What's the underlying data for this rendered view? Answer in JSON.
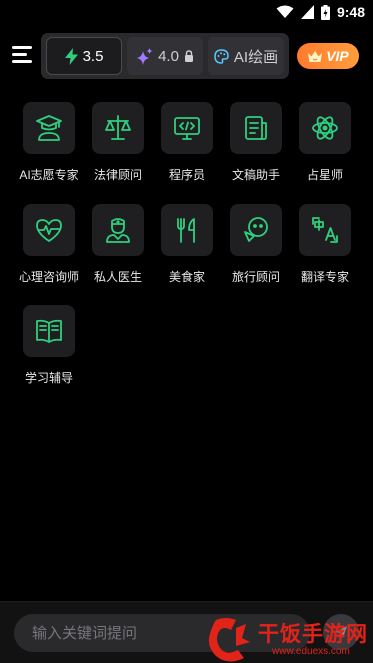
{
  "status_bar": {
    "time": "9:48"
  },
  "top_bar": {
    "models": [
      {
        "label": "3.5",
        "icon": "bolt-icon"
      },
      {
        "label": "4.0",
        "icon": "sparkle-icon",
        "locked": true
      },
      {
        "label": "AI绘画",
        "icon": "palette-icon"
      }
    ],
    "vip_label": "VIP"
  },
  "assistants": [
    {
      "label": "AI志愿专家",
      "icon": "graduate-icon"
    },
    {
      "label": "法律顾问",
      "icon": "scales-icon"
    },
    {
      "label": "程序员",
      "icon": "code-monitor-icon"
    },
    {
      "label": "文稿助手",
      "icon": "document-icon"
    },
    {
      "label": "占星师",
      "icon": "atom-icon"
    },
    {
      "label": "心理咨询师",
      "icon": "heart-pulse-icon"
    },
    {
      "label": "私人医生",
      "icon": "doctor-icon"
    },
    {
      "label": "美食家",
      "icon": "fork-knife-icon"
    },
    {
      "label": "旅行顾问",
      "icon": "travel-icon"
    },
    {
      "label": "翻译专家",
      "icon": "translate-icon"
    },
    {
      "label": "学习辅导",
      "icon": "book-icon"
    }
  ],
  "bottom_bar": {
    "search_placeholder": "输入关键词提问"
  },
  "watermark": {
    "title": "干饭手游网",
    "url": "www.eduexs.com"
  },
  "colors": {
    "accent_green": "#2fcf7e",
    "vip_orange": "#ff8c32",
    "background": "#000000",
    "tile": "#1f1f21",
    "watermark_red": "#e2231a"
  }
}
